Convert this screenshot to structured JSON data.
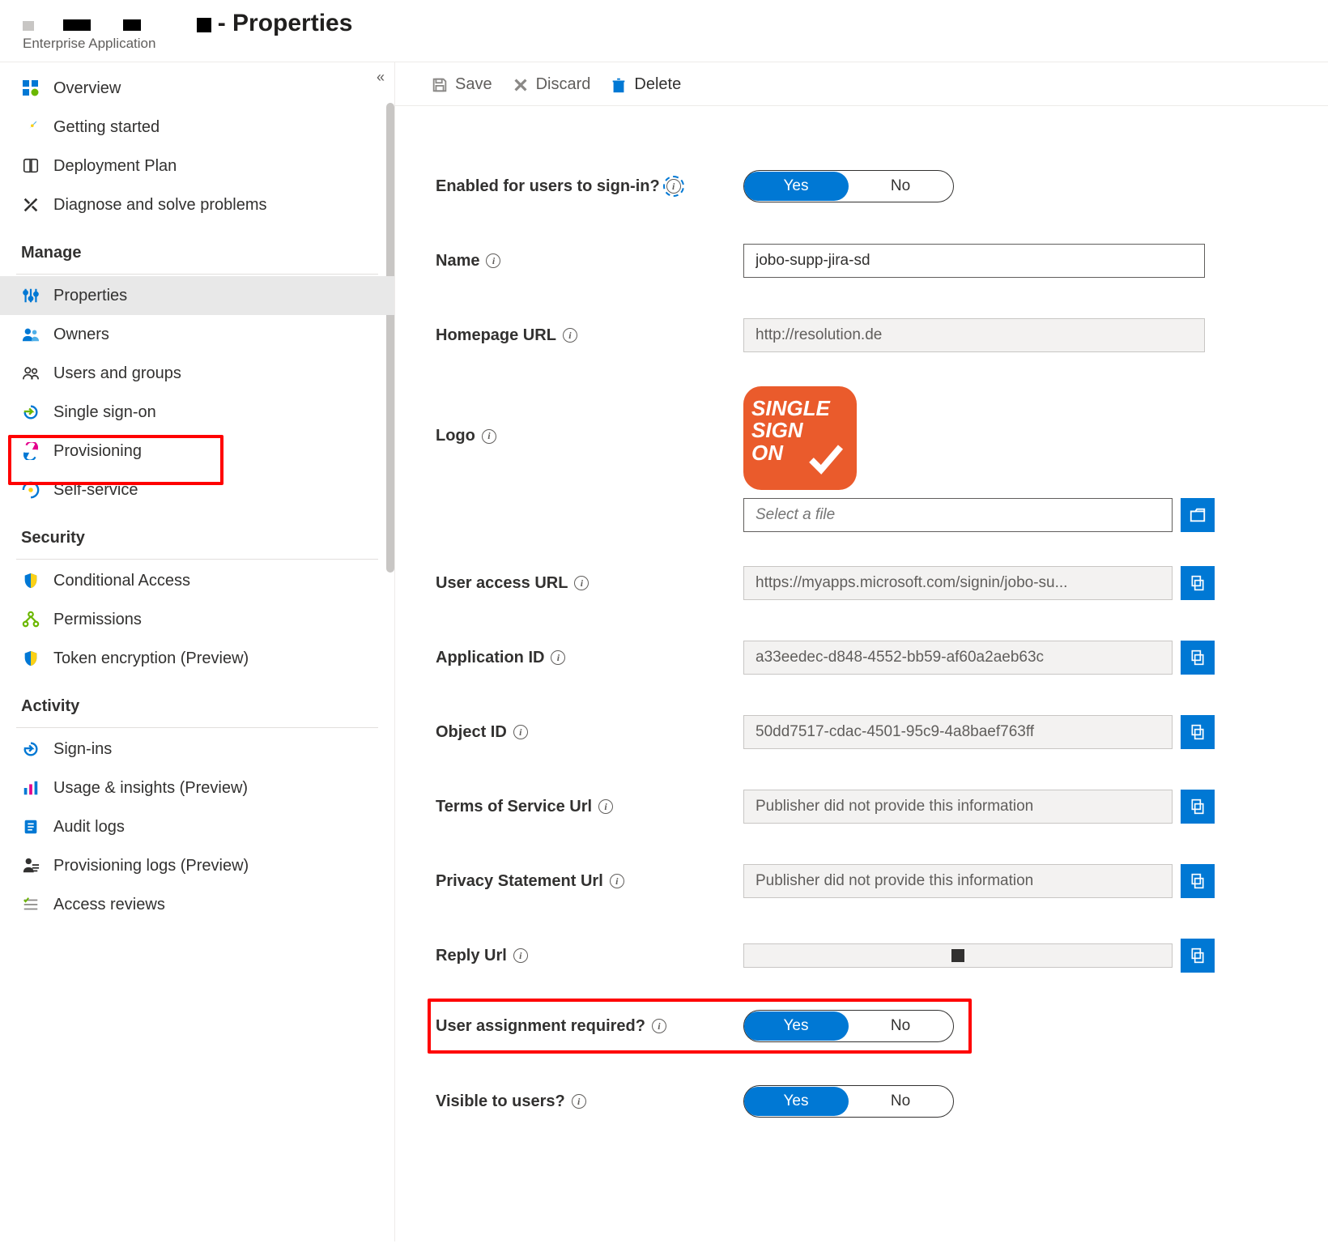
{
  "header": {
    "title_suffix": "- Properties",
    "subtitle": "Enterprise Application"
  },
  "toolbar": {
    "save": "Save",
    "discard": "Discard",
    "delete": "Delete"
  },
  "sidebar": {
    "overview": "Overview",
    "getting_started": "Getting started",
    "deployment_plan": "Deployment Plan",
    "diagnose": "Diagnose and solve problems",
    "section_manage": "Manage",
    "properties": "Properties",
    "owners": "Owners",
    "users_groups": "Users and groups",
    "sso": "Single sign-on",
    "provisioning": "Provisioning",
    "self_service": "Self-service",
    "section_security": "Security",
    "conditional_access": "Conditional Access",
    "permissions": "Permissions",
    "token_encryption": "Token encryption (Preview)",
    "section_activity": "Activity",
    "sign_ins": "Sign-ins",
    "usage": "Usage & insights (Preview)",
    "audit_logs": "Audit logs",
    "prov_logs": "Provisioning logs (Preview)",
    "access_reviews": "Access reviews"
  },
  "form": {
    "enabled_label": "Enabled for users to sign-in?",
    "name_label": "Name",
    "name_value": "jobo-supp-jira-sd",
    "homepage_label": "Homepage URL",
    "homepage_value": "http://resolution.de",
    "logo_label": "Logo",
    "logo_text_l1": "SINGLE",
    "logo_text_l2": "SIGN",
    "logo_text_l3": "ON",
    "logo_file_placeholder": "Select a file",
    "user_access_label": "User access URL",
    "user_access_value": "https://myapps.microsoft.com/signin/jobo-su...",
    "app_id_label": "Application ID",
    "app_id_value": "a33eedec-d848-4552-bb59-af60a2aeb63c",
    "object_id_label": "Object ID",
    "object_id_value": "50dd7517-cdac-4501-95c9-4a8baef763ff",
    "tos_label": "Terms of Service Url",
    "tos_value": "Publisher did not provide this information",
    "privacy_label": "Privacy Statement Url",
    "privacy_value": "Publisher did not provide this information",
    "reply_label": "Reply Url",
    "user_assign_label": "User assignment required?",
    "visible_label": "Visible to users?",
    "toggle_yes": "Yes",
    "toggle_no": "No"
  }
}
